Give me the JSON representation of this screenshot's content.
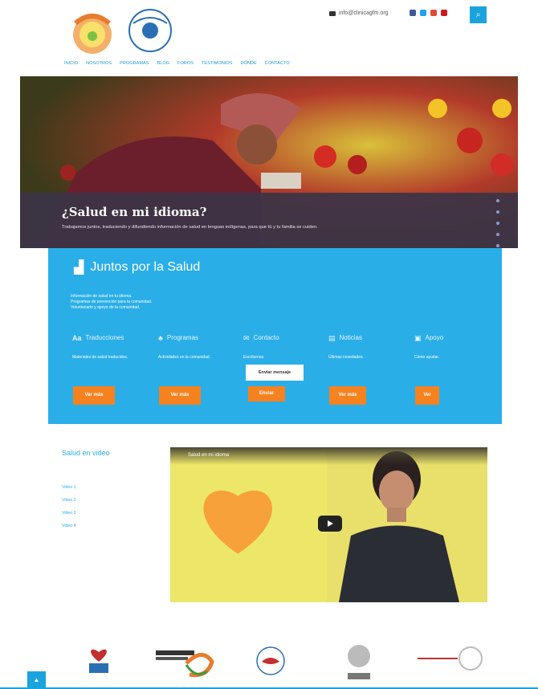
{
  "header": {
    "contact_email": "info@clinicagfm.org",
    "nav": [
      "INICIO",
      "NOSOTROS",
      "PROGRAMAS",
      "BLOG",
      "FOROS",
      "TESTIMONIOS",
      "DÓNDE",
      "CONTACTO"
    ],
    "socials": [
      {
        "name": "facebook-icon",
        "color": "#3b5998"
      },
      {
        "name": "twitter-icon",
        "color": "#1da1f2"
      },
      {
        "name": "google-plus-icon",
        "color": "#dd4b39"
      },
      {
        "name": "youtube-icon",
        "color": "#cc181e"
      }
    ]
  },
  "hero": {
    "title": "¿Salud en mi idioma?",
    "text": "Trabajamos juntos, traduciendo y difundiendo información de salud en lenguas indígenas, para que tú y tu familia se cuiden.",
    "slides": 5
  },
  "panel": {
    "title": "Juntos por la Salud",
    "bullets": [
      "Información de salud en tu idioma.",
      "Programas de prevención para la comunidad.",
      "Voluntariado y apoyo de la comunidad."
    ],
    "columns": [
      {
        "icon": "Aa",
        "title": "Traducciones",
        "desc": "Materiales de salud traducidos.",
        "button": "Ver más"
      },
      {
        "icon": "♣",
        "title": "Programas",
        "desc": "Actividades en la comunidad.",
        "button": "Ver más"
      },
      {
        "icon": "✉",
        "title": "Contacto",
        "desc": "Escríbenos.",
        "button": "Enviar",
        "tooltip": "Enviar mensaje"
      },
      {
        "icon": "▤",
        "title": "Noticias",
        "desc": "Últimas novedades.",
        "button": "Ver más"
      },
      {
        "icon": "▣",
        "title": "Apoyo",
        "desc": "Cómo ayudar.",
        "button": "Ver"
      }
    ]
  },
  "video_section": {
    "title": "Salud en video",
    "links": [
      "Video 1",
      "Video 2",
      "Video 3",
      "Video 4"
    ],
    "video_label": "Salud en mi idioma"
  },
  "footer": {
    "partner_logos": [
      "partner-logo-1",
      "partner-logo-2",
      "partner-logo-3",
      "partner-logo-4",
      "partner-logo-5"
    ],
    "back_to_top": "▲"
  }
}
